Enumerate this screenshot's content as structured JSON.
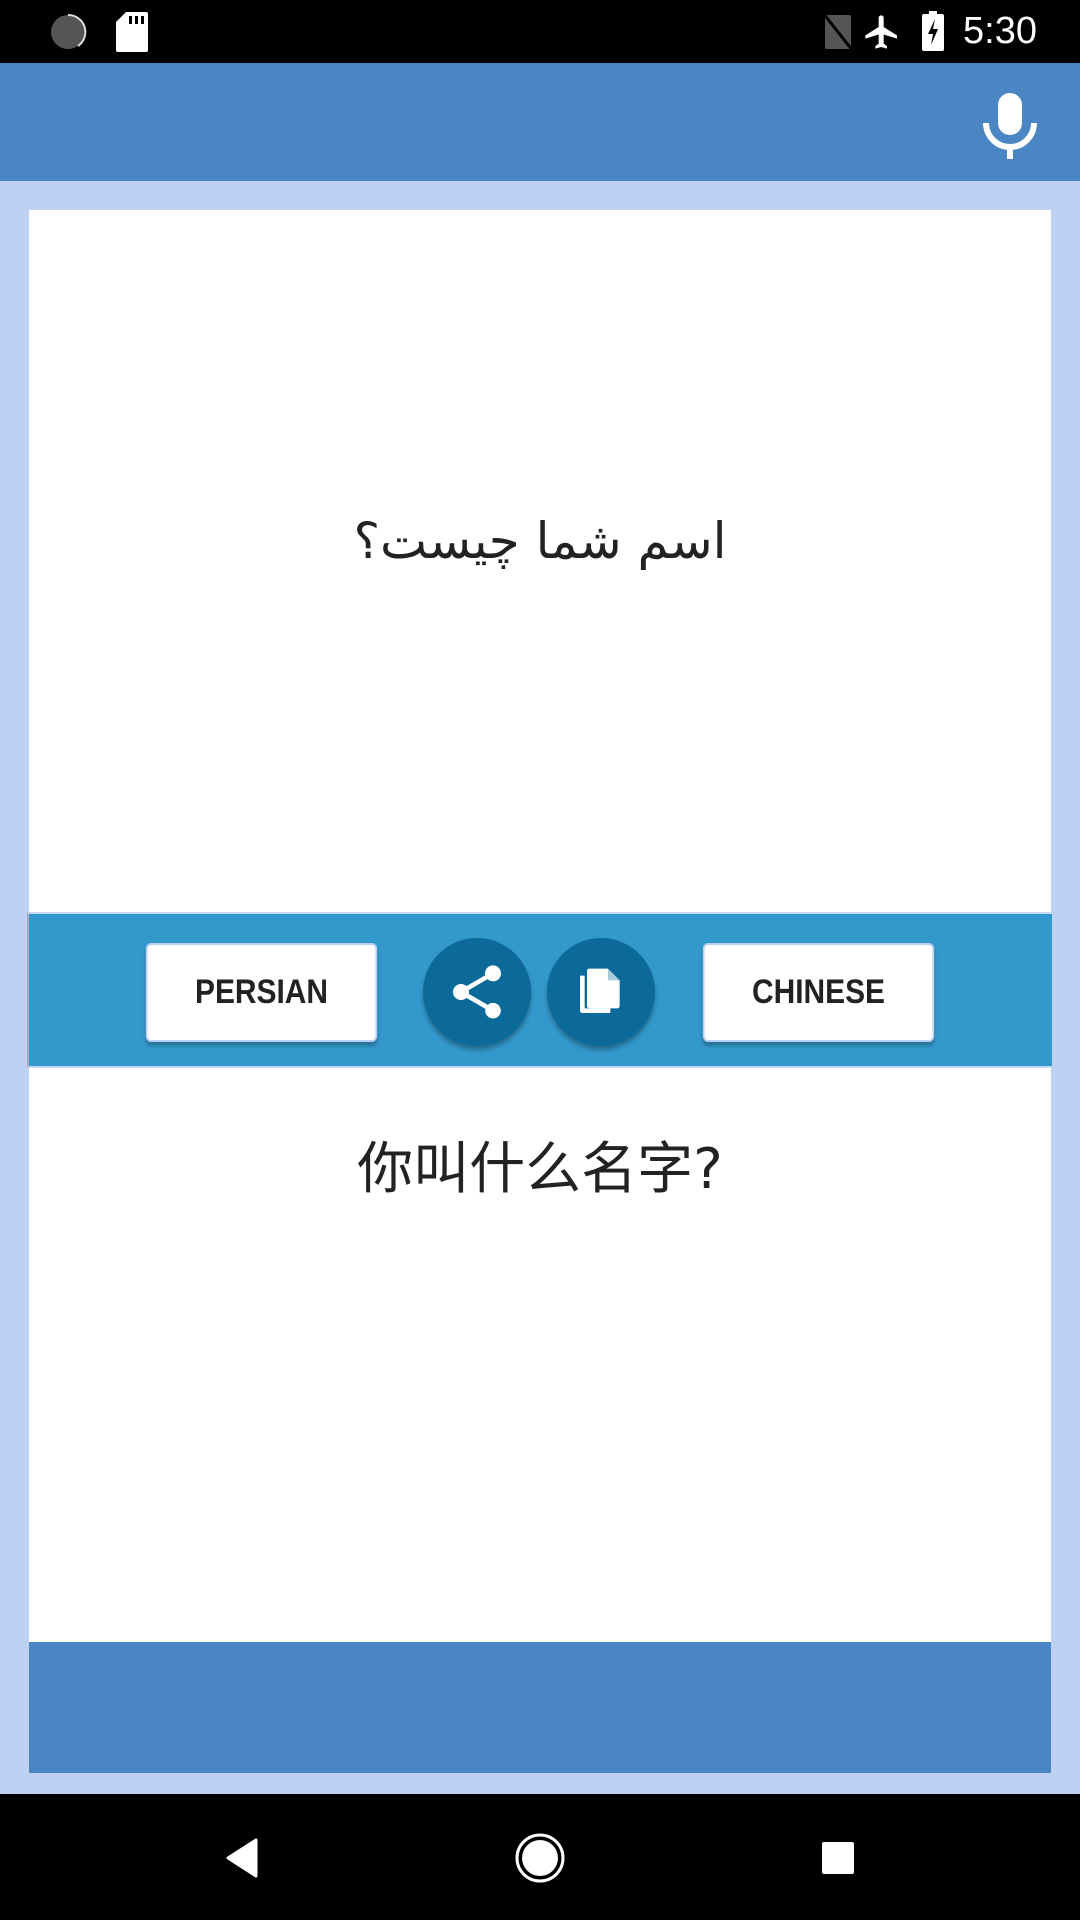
{
  "status_bar": {
    "time": "5:30",
    "left_icons": [
      "sync-icon",
      "sd-card-icon"
    ],
    "right_icons": [
      "no-sim-icon",
      "airplane-mode-icon",
      "battery-charging-icon"
    ]
  },
  "toolbar": {
    "mic_icon": "microphone-icon"
  },
  "source": {
    "text": "اسم شما چیست؟",
    "language": "Persian"
  },
  "controls": {
    "source_language_label": "PERSIAN",
    "target_language_label": "CHINESE",
    "share_icon": "share-icon",
    "copy_icon": "copy-icon"
  },
  "target": {
    "text": "你叫什么名字?",
    "language": "Chinese"
  },
  "nav_bar": {
    "buttons": [
      "back",
      "home",
      "recents"
    ]
  },
  "colors": {
    "toolbar": "#4A86C3",
    "background": "#BFD1F2",
    "control_bar": "#3399CC",
    "circle_button": "#0B6A9A"
  }
}
